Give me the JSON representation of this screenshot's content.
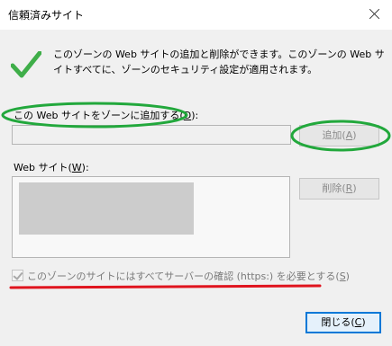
{
  "window": {
    "title": "信頼済みサイト"
  },
  "description": "このゾーンの Web サイトの追加と削除ができます。このゾーンの Web サイトすべてに、ゾーンのセキュリティ設定が適用されます。",
  "add_section": {
    "label_prefix": "この Web サイトをゾーンに追加する(",
    "label_key": "D",
    "label_suffix": "):",
    "input_value": "",
    "add_button_prefix": "追加(",
    "add_button_key": "A",
    "add_button_suffix": ")"
  },
  "sites_section": {
    "label_prefix": "Web サイト(",
    "label_key": "W",
    "label_suffix": "):",
    "remove_button_prefix": "削除(",
    "remove_button_key": "R",
    "remove_button_suffix": ")"
  },
  "https_checkbox": {
    "checked": true,
    "label_prefix": "このゾーンのサイトにはすべてサーバーの確認 (https:) を必要とする(",
    "label_key": "S",
    "label_suffix": ")"
  },
  "close_button": {
    "prefix": "閉じる(",
    "key": "C",
    "suffix": ")"
  },
  "annotations": {
    "green": "#22a83c",
    "red": "#e0141e"
  }
}
